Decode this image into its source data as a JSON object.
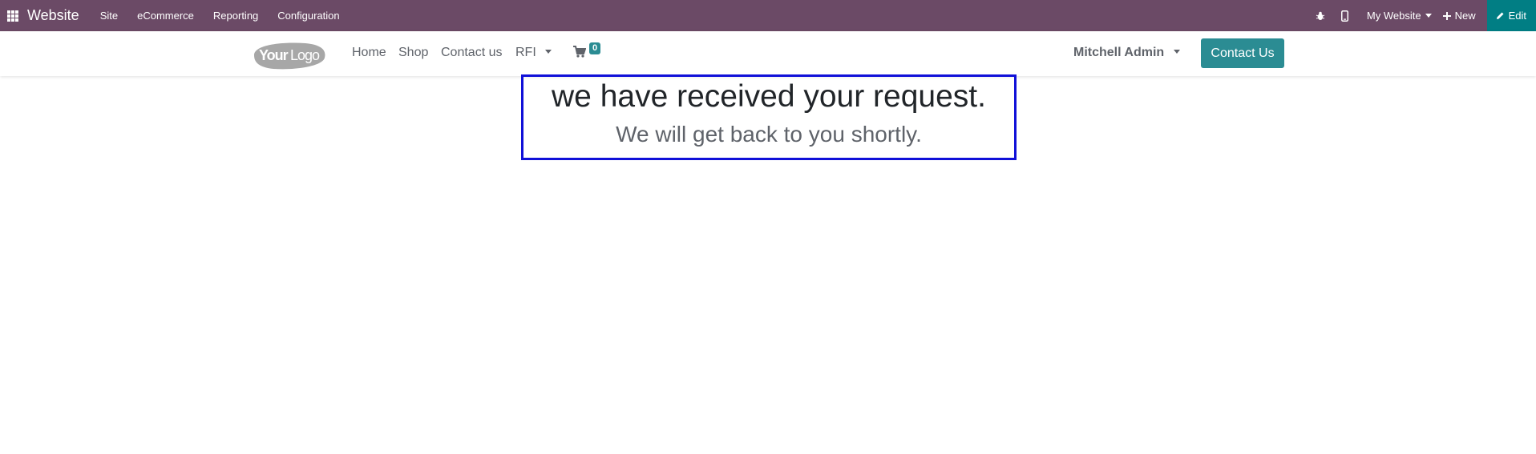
{
  "topbar": {
    "brand": "Website",
    "menu": [
      "Site",
      "eCommerce",
      "Reporting",
      "Configuration"
    ],
    "website_selector": "My Website",
    "new_label": "New",
    "edit_label": "Edit",
    "icons": [
      "apps-icon",
      "bug-icon",
      "mobile-icon",
      "plus-icon",
      "pencil-icon"
    ]
  },
  "header": {
    "logo_text": "YourLogo",
    "nav": [
      "Home",
      "Shop",
      "Contact us",
      "RFI"
    ],
    "cart_count": "0",
    "user_name": "Mitchell Admin",
    "contact_button": "Contact Us"
  },
  "main": {
    "title": "we have received your request.",
    "subtitle": "We will get back to you shortly."
  },
  "colors": {
    "topbar": "#6b4a66",
    "edit_button": "#017e84",
    "primary": "#2b8c93",
    "highlight_border": "#1010d8"
  }
}
